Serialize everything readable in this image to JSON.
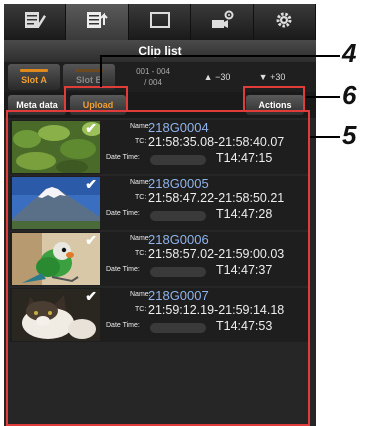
{
  "topbar": {
    "items": [
      {
        "name": "edit-icon"
      },
      {
        "name": "clip-list-icon",
        "active": true
      },
      {
        "name": "display-icon"
      },
      {
        "name": "camera-settings-icon"
      },
      {
        "name": "gear-icon"
      }
    ]
  },
  "title": "Clip list",
  "slots": {
    "slot_a": "Slot A",
    "slot_b": "Slot B",
    "range_line1": "001 - 004",
    "range_line2": "/ 004",
    "prev_page": "▲ −30",
    "next_page": "▼ +30"
  },
  "actions": {
    "meta_data": "Meta data",
    "upload": "Upload",
    "actions": "Actions"
  },
  "labels": {
    "name": "Name:",
    "tc": "TC:",
    "date_time": "Date Time:"
  },
  "clips": [
    {
      "name": "218G0004",
      "tc": "21:58:35.08-21:58:40.07",
      "time": "T14:47:15",
      "checked": "✔",
      "scene": "leaves"
    },
    {
      "name": "218G0005",
      "tc": "21:58:47.22-21:58:50.21",
      "time": "T14:47:28",
      "checked": "✔",
      "scene": "mountain"
    },
    {
      "name": "218G0006",
      "tc": "21:58:57.02-21:59:00.03",
      "time": "T14:47:37",
      "checked": "✔",
      "scene": "parrot"
    },
    {
      "name": "218G0007",
      "tc": "21:59:12.19-21:59:14.18",
      "time": "T14:47:53",
      "checked": "✔",
      "scene": "cat"
    }
  ],
  "callouts": {
    "c4": "4",
    "c5": "5",
    "c6": "6"
  },
  "colors": {
    "accent": "#e08a1e",
    "name_text": "#8fb4e8",
    "callout_border": "#e03c3c"
  }
}
